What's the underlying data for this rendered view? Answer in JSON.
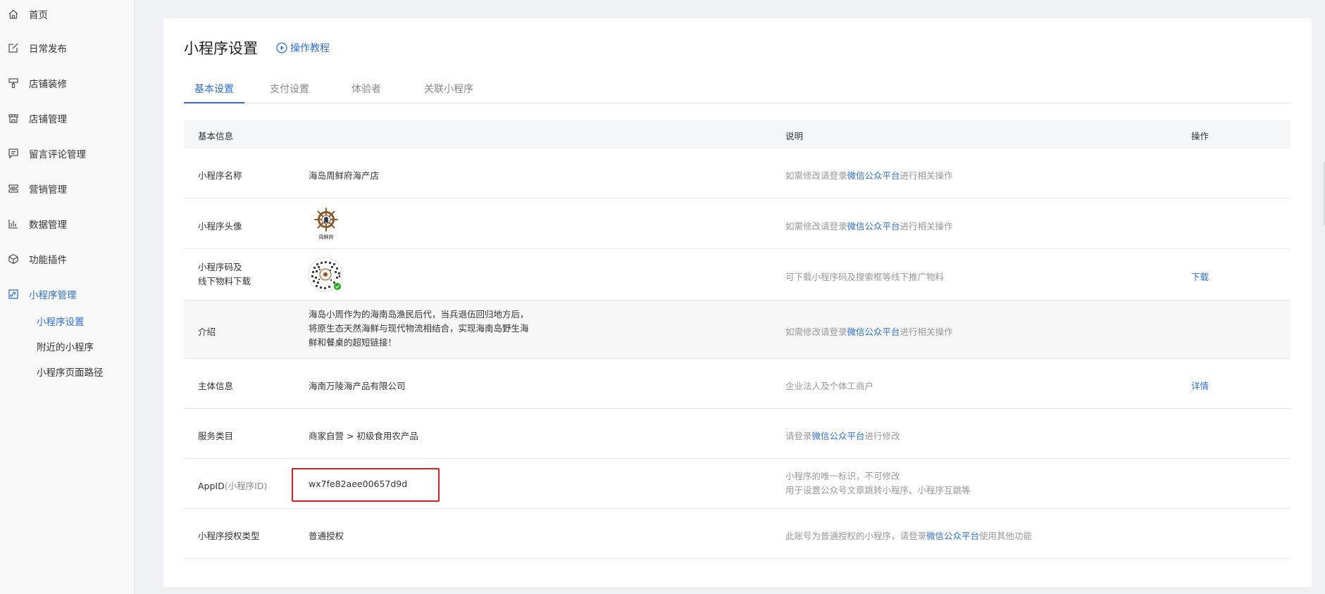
{
  "sidebar": {
    "items": [
      {
        "label": "首页",
        "icon": "home-icon"
      },
      {
        "label": "日常发布",
        "icon": "edit-icon"
      },
      {
        "label": "店铺装修",
        "icon": "brush-icon"
      },
      {
        "label": "店铺管理",
        "icon": "store-icon"
      },
      {
        "label": "留言评论管理",
        "icon": "comment-icon"
      },
      {
        "label": "营销管理",
        "icon": "ticket-icon"
      },
      {
        "label": "数据管理",
        "icon": "bar-chart-icon"
      },
      {
        "label": "功能插件",
        "icon": "cube-icon"
      },
      {
        "label": "小程序管理",
        "icon": "miniprogram-icon"
      }
    ],
    "subitems": [
      {
        "label": "小程序设置"
      },
      {
        "label": "附近的小程序"
      },
      {
        "label": "小程序页面路径"
      }
    ]
  },
  "header": {
    "title": "小程序设置",
    "tutorial": "操作教程"
  },
  "tabs": [
    "基本设置",
    "支付设置",
    "体验者",
    "关联小程序"
  ],
  "table": {
    "headers": {
      "basic": "基本信息",
      "desc": "说明",
      "action": "操作"
    },
    "name": {
      "label": "小程序名称",
      "value": "海岛周鲜府海产店",
      "desc_pre": "如需修改请登录",
      "desc_link": "微信公众平台",
      "desc_post": "进行相关操作"
    },
    "avatar": {
      "label": "小程序头像",
      "logo_text": "周鲜府",
      "desc_pre": "如需修改请登录",
      "desc_link": "微信公众平台",
      "desc_post": "进行相关操作"
    },
    "qrcode": {
      "label_line1": "小程序码及",
      "label_line2": "线下物料下载",
      "desc": "可下载小程序码及搜索框等线下推广物料",
      "action": "下载"
    },
    "intro": {
      "label": "介绍",
      "line1": "海岛小周作为的海南岛渔民后代，当兵退伍回归地方后，",
      "line2": "将原生态天然海鲜与现代物流相结合，实现海南岛野生海",
      "line3": "鲜和餐桌的超短链接！",
      "desc_pre": "如需修改请登录",
      "desc_link": "微信公众平台",
      "desc_post": "进行相关操作"
    },
    "entity": {
      "label": "主体信息",
      "value": "海南万陵海产品有限公司",
      "desc": "企业法人及个体工商户",
      "action": "详情"
    },
    "category": {
      "label": "服务类目",
      "value": "商家自营 > 初级食用农产品",
      "desc_pre": "请登录",
      "desc_link": "微信公众平台",
      "desc_post": "进行修改"
    },
    "appid": {
      "label": "AppID",
      "label_suffix": "(小程序ID)",
      "value": "wx7fe82aee00657d9d",
      "desc_line1": "小程序的唯一标识，不可修改",
      "desc_line2": "用于设置公众号文章跳转小程序、小程序互跳等"
    },
    "auth": {
      "label": "小程序授权类型",
      "value": "普通授权",
      "desc_pre": "此账号为普通授权的小程序，请登录",
      "desc_link": "微信公众平台",
      "desc_post": "使用其他功能"
    }
  },
  "colors": {
    "accent": "#2c6fd8",
    "highlight_border": "#e21a1a",
    "sidebar_bg": "#f9f9fa",
    "page_bg": "#f0f1f4"
  }
}
